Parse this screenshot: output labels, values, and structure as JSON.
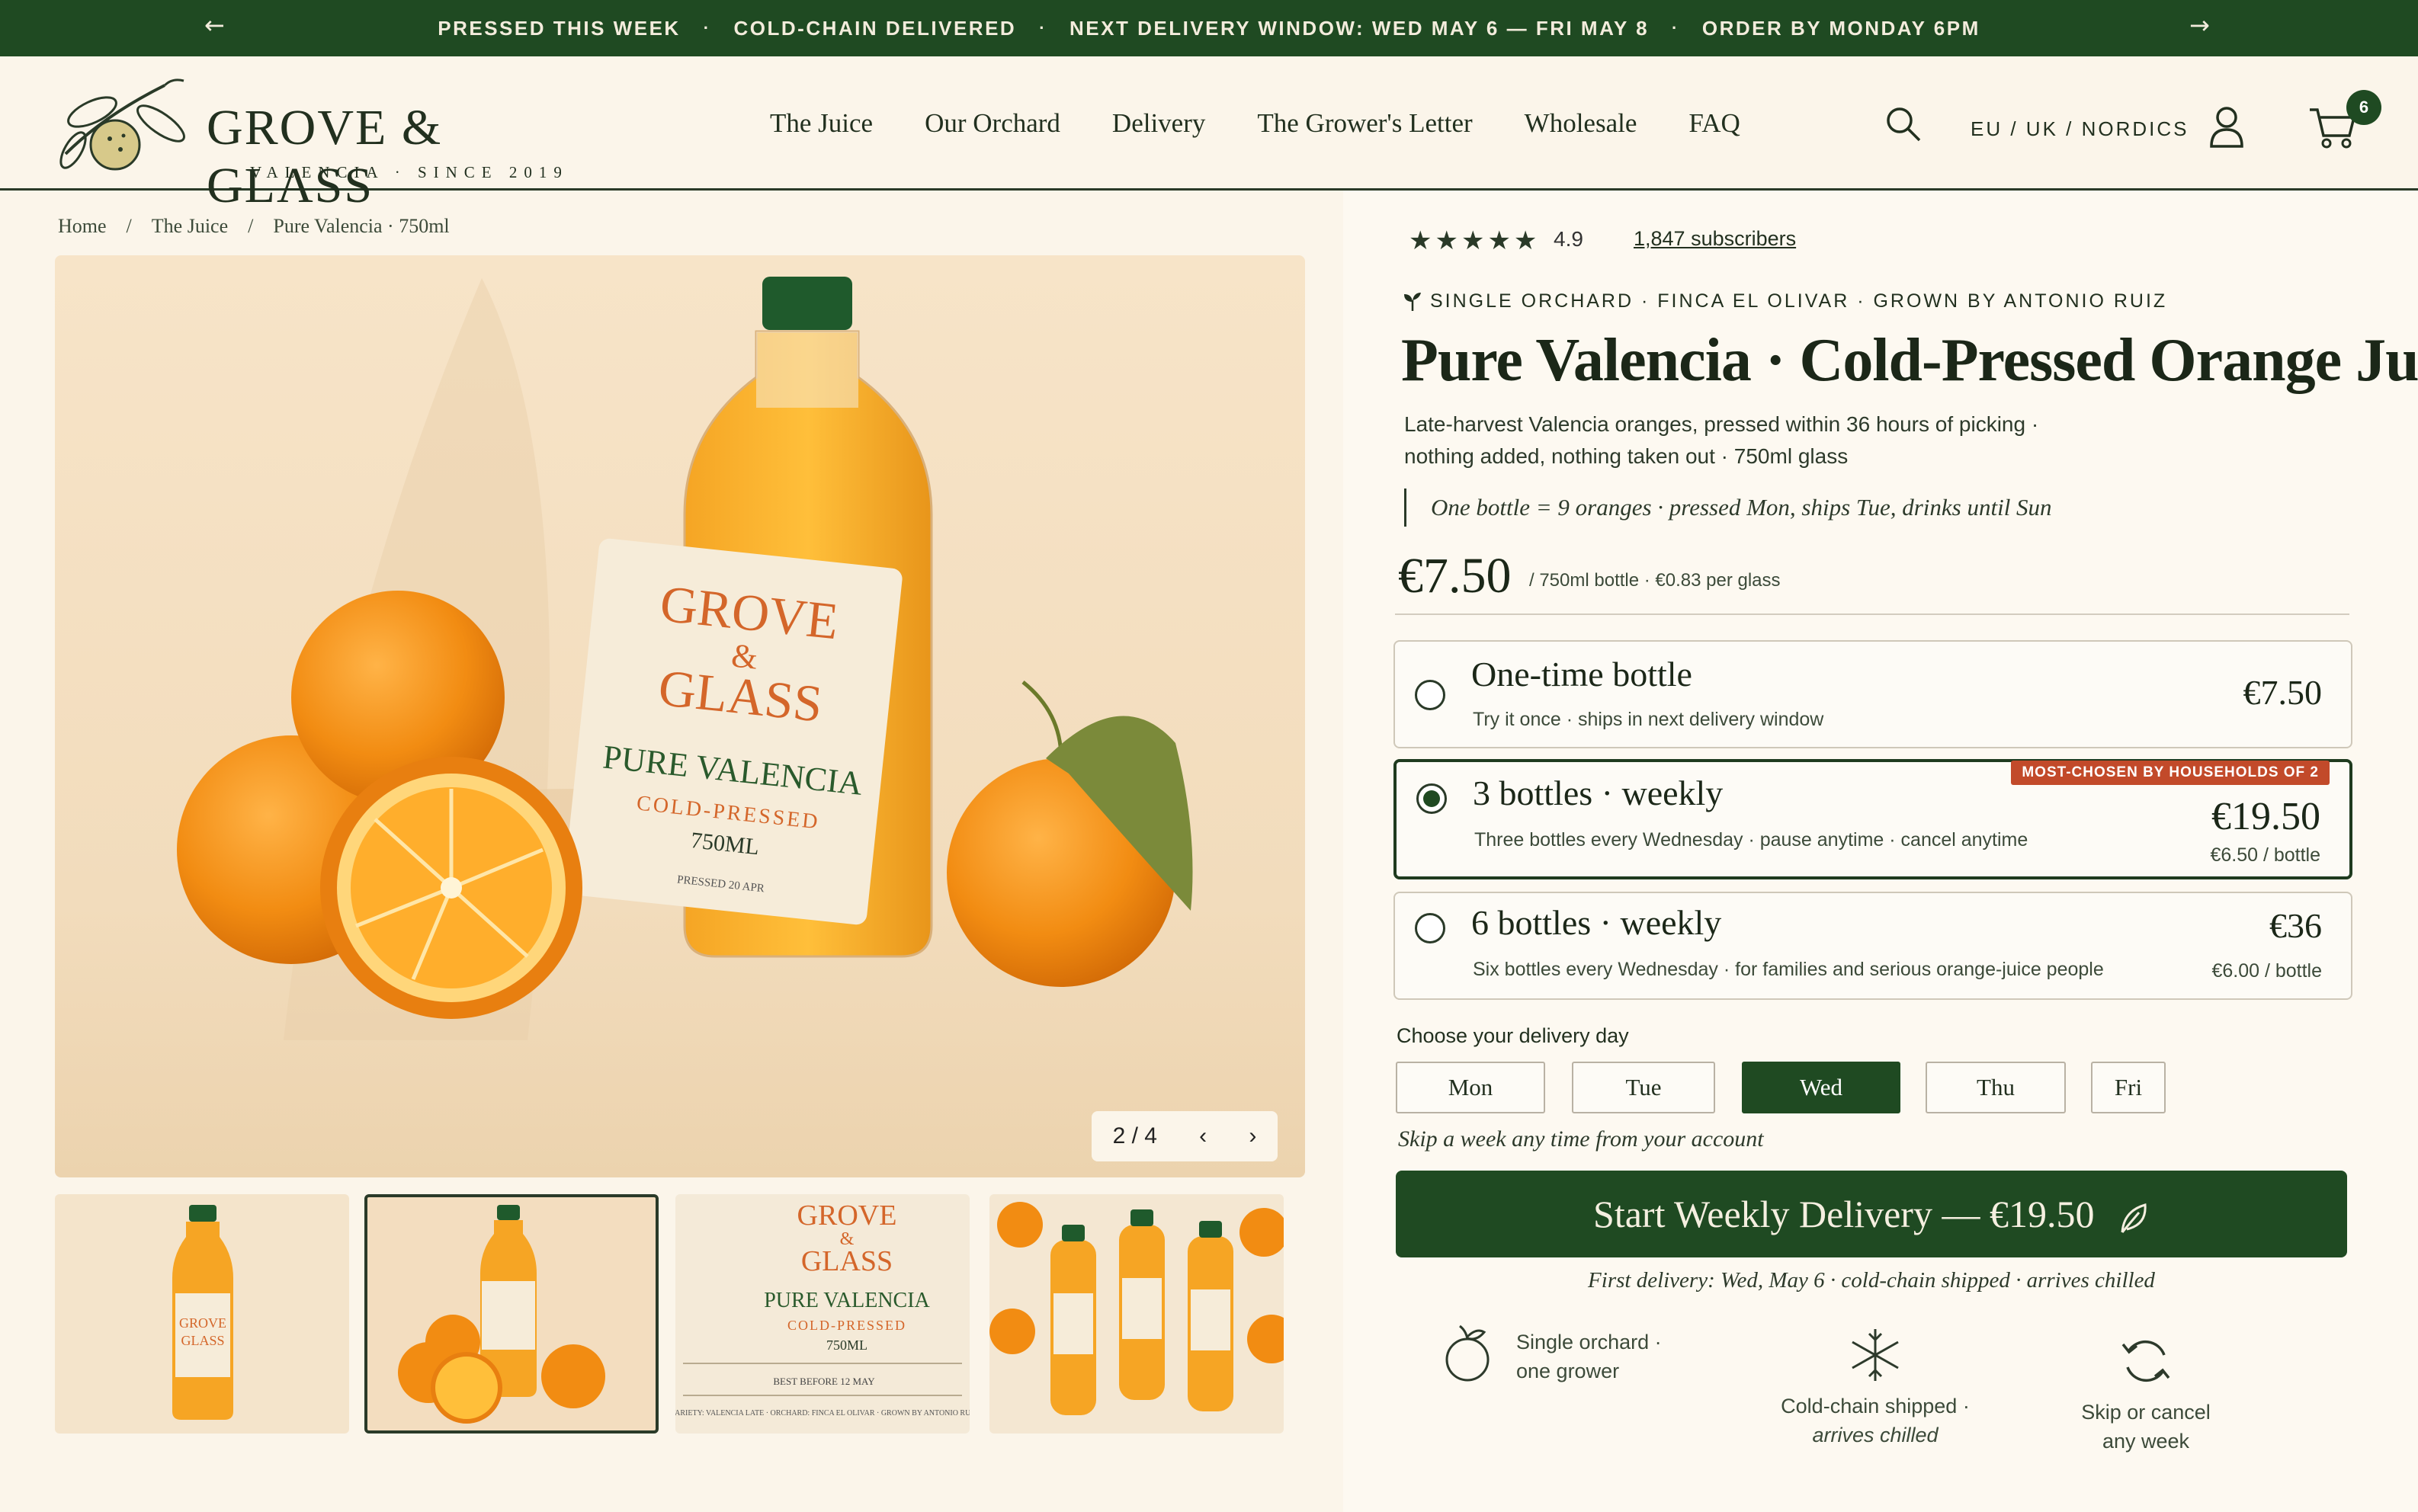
{
  "banner": {
    "messages": [
      "PRESSED THIS WEEK",
      "COLD-CHAIN DELIVERED",
      "NEXT DELIVERY WINDOW: WED MAY 6 — FRI MAY 8",
      "ORDER BY MONDAY 6PM"
    ],
    "separator": "·",
    "prev_icon": "←",
    "next_icon": "→"
  },
  "header": {
    "logo_name": "GROVE & GLASS",
    "logo_sub": "VALENCIA · SINCE 2019",
    "nav": [
      "The Juice",
      "Our Orchard",
      "Delivery",
      "The Grower's Letter",
      "Wholesale",
      "FAQ"
    ],
    "region": "EU / UK / NORDICS",
    "cart_count": "6"
  },
  "breadcrumb": [
    "Home",
    "/",
    "The Juice",
    "/",
    "Pure Valencia · 750ml"
  ],
  "gallery": {
    "label_brand_1": "GROVE",
    "label_amp": "&",
    "label_brand_2": "GLASS",
    "label_product": "PURE VALENCIA",
    "label_method": "COLD-PRESSED",
    "label_size": "750ML",
    "label_pressed": "PRESSED 20 APR",
    "label_best": "BEST BEFORE 12 MAY",
    "label_orchard": "SINGLE ORCHARD",
    "label_variety": "VARIETY: VALENCIA LATE · ORCHARD: FINCA EL OLIVAR · GROWN BY ANTONIO RUIZ",
    "pager": "2 / 4",
    "prev_icon": "‹",
    "next_icon": "›"
  },
  "product": {
    "stars": "★★★★★",
    "rating": "4.9",
    "subscribers": "1,847 subscribers",
    "origin": "SINGLE ORCHARD · FINCA EL OLIVAR · GROWN BY ANTONIO RUIZ",
    "title": "Pure Valencia · Cold-Pressed Orange Juice",
    "desc_line1": "Late-harvest Valencia oranges, pressed within 36 hours of picking ·",
    "desc_line2": "nothing added, nothing taken out · 750ml glass",
    "note": "One bottle = 9 oranges · pressed Mon, ships Tue, drinks until Sun",
    "price": "€7.50",
    "price_unit": "/ 750ml bottle · €0.83 per glass"
  },
  "plans": [
    {
      "name": "One-time bottle",
      "sub": "Try it once · ships in next delivery window",
      "price": "€7.50",
      "unit": "",
      "tag": ""
    },
    {
      "name": "3 bottles · weekly",
      "sub": "Three bottles every Wednesday · pause anytime · cancel anytime",
      "price": "€19.50",
      "unit": "€6.50 / bottle",
      "tag": "MOST-CHOSEN BY HOUSEHOLDS OF 2"
    },
    {
      "name": "6 bottles · weekly",
      "sub": "Six bottles every Wednesday · for families and serious orange-juice people",
      "price": "€36",
      "unit": "€6.00 / bottle",
      "tag": ""
    }
  ],
  "selected_plan": "3 bottles · weekly",
  "delivery": {
    "label": "Choose your delivery day",
    "days": [
      "Mon",
      "Tue",
      "Wed",
      "Thu",
      "Fri"
    ],
    "selected": "Wed",
    "skip_note": "Skip a week any time from your account"
  },
  "cta": {
    "label": "Start Weekly Delivery — €19.50",
    "first_delivery": "First delivery: Wed, May 6 · cold-chain shipped · arrives chilled"
  },
  "features": [
    {
      "line1": "Single orchard ·",
      "line2": "one grower",
      "icon": "orange-icon"
    },
    {
      "line1": "Cold-chain shipped ·",
      "line2": "arrives chilled",
      "icon": "snowflake-icon"
    },
    {
      "line1": "Skip or cancel",
      "line2": "any week",
      "icon": "refresh-icon"
    }
  ],
  "colors": {
    "brand_green": "#1f4a22",
    "background": "#fbf5ea",
    "tag_red": "#c24a2a",
    "label_orange": "#d4662a"
  }
}
